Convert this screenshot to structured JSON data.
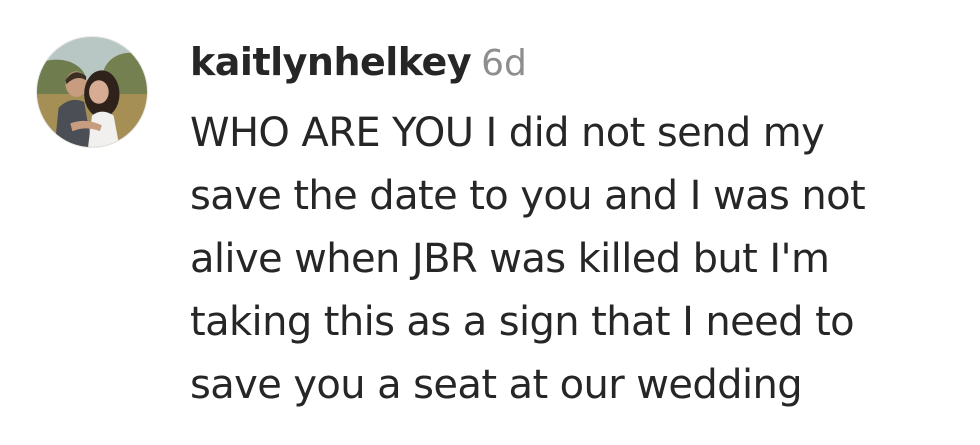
{
  "comment": {
    "username": "kaitlynhelkey",
    "timestamp": "6d",
    "text_lines": [
      "WHO ARE YOU I did not send my",
      "save the date to you and I was not",
      "alive when JBR was killed but I'm",
      "taking this as a sign that I need to",
      "save you a seat at our wedding"
    ]
  },
  "colors": {
    "text": "#262626",
    "secondary_text": "#8e8e8e",
    "background": "#ffffff"
  },
  "icons": {
    "avatar": "profile-photo-couple"
  }
}
